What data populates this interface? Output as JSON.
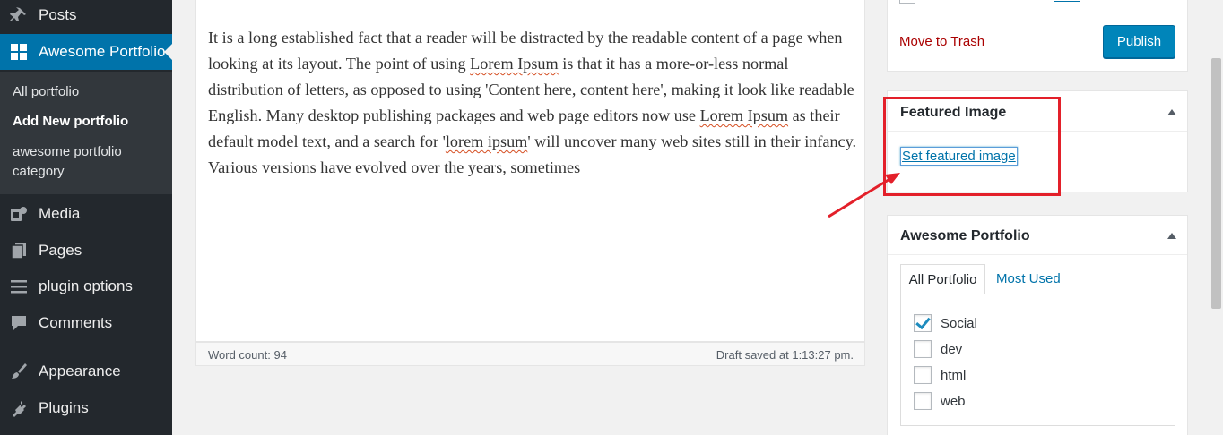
{
  "sidebar": {
    "items": [
      {
        "label": "Posts",
        "icon": "pin-icon"
      },
      {
        "label": "Awesome Portfolio",
        "icon": "grid-icon",
        "active": true
      },
      {
        "label": "Media",
        "icon": "media-icon"
      },
      {
        "label": "Pages",
        "icon": "pages-icon"
      },
      {
        "label": "plugin options",
        "icon": "list-icon"
      },
      {
        "label": "Comments",
        "icon": "comment-icon"
      },
      {
        "label": "Appearance",
        "icon": "brush-icon"
      },
      {
        "label": "Plugins",
        "icon": "plug-icon"
      }
    ],
    "submenu": [
      {
        "label": "All portfolio"
      },
      {
        "label": "Add New portfolio",
        "current": true
      },
      {
        "label": "awesome portfolio category"
      }
    ]
  },
  "editor": {
    "text": {
      "p1": "It is a long established fact that a reader will be distracted by the readable content of a page when looking at its layout. The point of using ",
      "s1": "Lorem Ipsum",
      "p2": " is that it has a more-or-less normal distribution of letters, as opposed to using 'Content here, content here', making it look like readable English. Many desktop publishing packages and web page editors now use ",
      "s2": "Lorem Ipsum",
      "p3": " as their default model text, and a search for '",
      "s3": "lorem ipsum",
      "p4": "' will uncover many web sites still in their infancy. Various versions have evolved over the years, sometimes"
    },
    "word_count": "Word count: 94",
    "draft_status": "Draft saved at 1:13:27 pm."
  },
  "publish": {
    "trash_label": "Move to Trash",
    "publish_label": "Publish"
  },
  "featured_image": {
    "title": "Featured Image",
    "set_label": "Set featured image"
  },
  "portfolio_box": {
    "title": "Awesome Portfolio",
    "tabs": [
      "All Portfolio",
      "Most Used"
    ],
    "categories": [
      {
        "label": "Social",
        "checked": true
      },
      {
        "label": "dev",
        "checked": false
      },
      {
        "label": "html",
        "checked": false
      },
      {
        "label": "web",
        "checked": false
      }
    ]
  },
  "colors": {
    "sidebar_bg": "#23282d",
    "active_menu": "#0073aa",
    "publish_button": "#0085ba",
    "annotation_red": "#e3202a",
    "link": "#0073aa",
    "trash": "#aa0000"
  }
}
